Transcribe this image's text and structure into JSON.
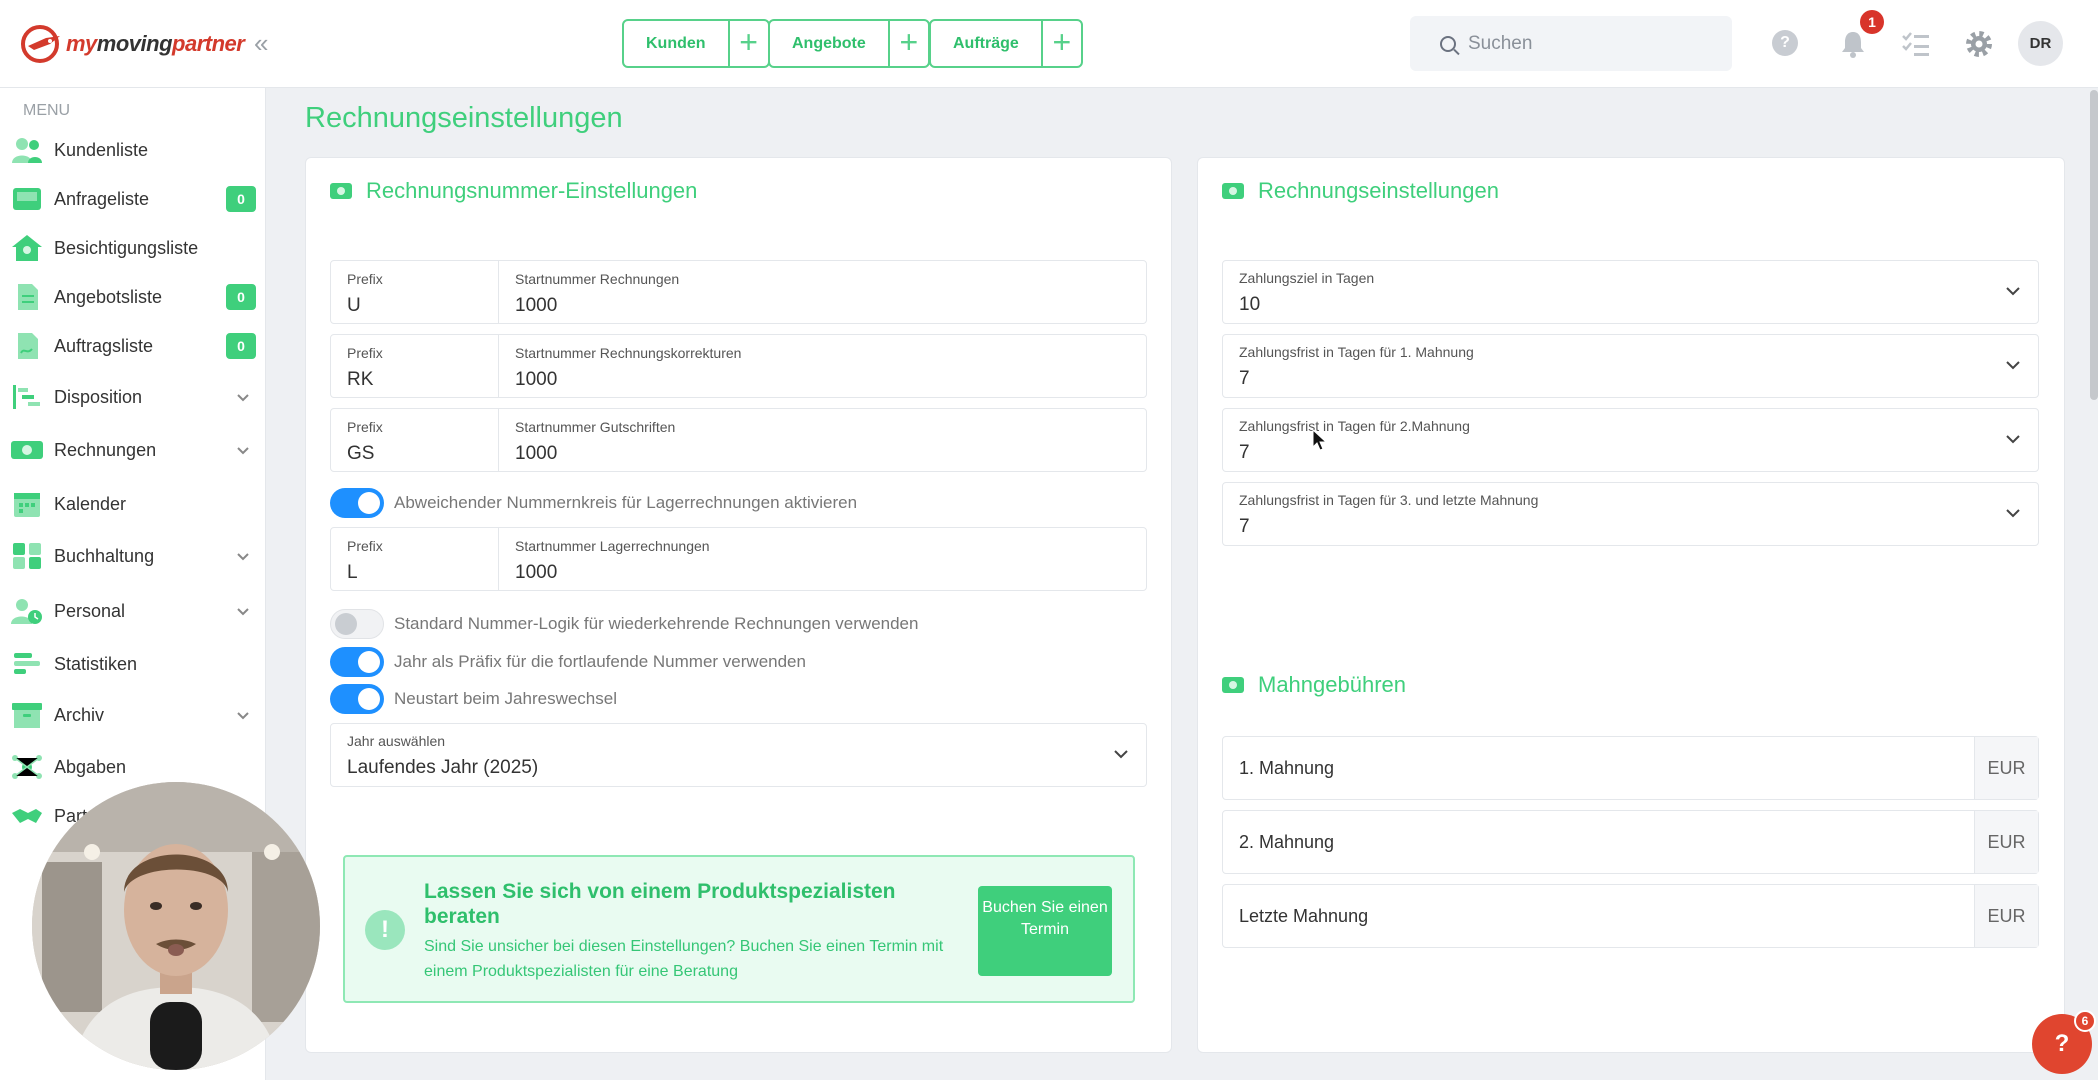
{
  "brand": {
    "name_part1": "my",
    "name_part2": "moving",
    "name_part3": "partner"
  },
  "topbar": {
    "quick": [
      {
        "label": "Kunden"
      },
      {
        "label": "Angebote"
      },
      {
        "label": "Aufträge"
      }
    ],
    "search_placeholder": "Suchen",
    "help_glyph": "?",
    "notification_count": "1",
    "avatar_initials": "DR"
  },
  "sidebar": {
    "menu_title": "MENU",
    "items": [
      {
        "label": "Kundenliste",
        "icon": "users-icon"
      },
      {
        "label": "Anfrageliste",
        "icon": "inbox-icon",
        "count": "0"
      },
      {
        "label": "Besichtigungsliste",
        "icon": "house-icon"
      },
      {
        "label": "Angebotsliste",
        "icon": "document-icon",
        "count": "0"
      },
      {
        "label": "Auftragsliste",
        "icon": "contract-icon",
        "count": "0"
      },
      {
        "label": "Disposition",
        "icon": "gantt-icon",
        "expandable": true
      },
      {
        "label": "Rechnungen",
        "icon": "money-icon",
        "expandable": true
      },
      {
        "label": "Kalender",
        "icon": "calendar-icon"
      },
      {
        "label": "Buchhaltung",
        "icon": "calculator-icon",
        "expandable": true
      },
      {
        "label": "Personal",
        "icon": "staff-clock-icon",
        "expandable": true
      },
      {
        "label": "Statistiken",
        "icon": "bar-chart-icon"
      },
      {
        "label": "Archiv",
        "icon": "archive-icon",
        "expandable": true
      },
      {
        "label": "Abgaben",
        "icon": "network-icon"
      },
      {
        "label": "Part",
        "icon": "handshake-icon"
      }
    ]
  },
  "main": {
    "page_title": "Rechnungseinstellungen",
    "left": {
      "heading": "Rechnungsnummer-Einstellungen",
      "number_rows": [
        {
          "prefix_label": "Prefix",
          "prefix_value": "U",
          "start_label": "Startnummer Rechnungen",
          "start_value": "1000"
        },
        {
          "prefix_label": "Prefix",
          "prefix_value": "RK",
          "start_label": "Startnummer Rechnungskorrekturen",
          "start_value": "1000"
        },
        {
          "prefix_label": "Prefix",
          "prefix_value": "GS",
          "start_label": "Startnummer Gutschriften",
          "start_value": "1000"
        }
      ],
      "toggle_storage": {
        "label": "Abweichender Nummernkreis für Lagerrechnungen aktivieren",
        "on": true
      },
      "storage_row": {
        "prefix_label": "Prefix",
        "prefix_value": "L",
        "start_label": "Startnummer Lagerrechnungen",
        "start_value": "1000"
      },
      "toggles": [
        {
          "label": "Standard Nummer-Logik für wiederkehrende Rechnungen verwenden",
          "on": false
        },
        {
          "label": "Jahr als Präfix für die fortlaufende Nummer verwenden",
          "on": true
        },
        {
          "label": "Neustart beim Jahreswechsel",
          "on": true
        }
      ],
      "year_select": {
        "label": "Jahr auswählen",
        "value": "Laufendes Jahr (2025)"
      },
      "consult": {
        "title": "Lassen Sie sich von einem Produktspezialisten beraten",
        "text": "Sind Sie unsicher bei diesen Einstellungen? Buchen Sie einen Termin mit einem Produktspezialisten für eine Beratung",
        "button": "Buchen Sie einen Termin",
        "icon_glyph": "!"
      }
    },
    "right": {
      "heading": "Rechnungseinstellungen",
      "selects": [
        {
          "label": "Zahlungsziel in Tagen",
          "value": "10"
        },
        {
          "label": "Zahlungsfrist in Tagen für 1. Mahnung",
          "value": "7"
        },
        {
          "label": "Zahlungsfrist in Tagen für 2.Mahnung",
          "value": "7"
        },
        {
          "label": "Zahlungsfrist in Tagen für 3. und letzte Mahnung",
          "value": "7"
        }
      ],
      "fees_heading": "Mahngebühren",
      "fees": [
        {
          "placeholder": "1. Mahnung",
          "currency": "EUR"
        },
        {
          "placeholder": "2. Mahnung",
          "currency": "EUR"
        },
        {
          "placeholder": "Letzte Mahnung",
          "currency": "EUR"
        }
      ]
    }
  },
  "help_fab": {
    "glyph": "?",
    "count": "6"
  },
  "colors": {
    "accent": "#3fcf7c",
    "toggle_on": "#1e90ff",
    "badge": "#d8342a"
  }
}
